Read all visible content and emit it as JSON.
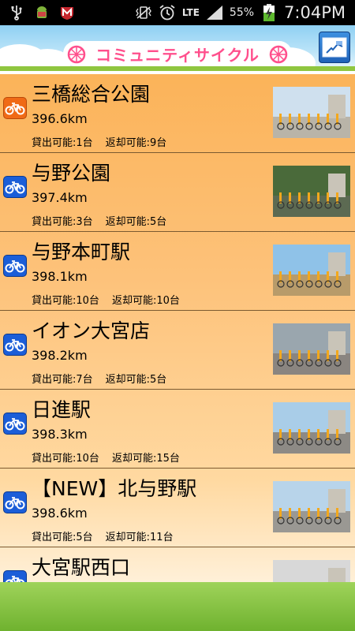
{
  "status_bar": {
    "icons": [
      "usb-icon",
      "android-debug-icon",
      "mcafee-icon",
      "vibrate-icon",
      "alarm-icon",
      "signal-icon",
      "battery-charging-icon"
    ],
    "network": "LTE",
    "battery": "55%",
    "time": "7:04PM"
  },
  "header": {
    "title": "コミュニティサイクル",
    "map_button_icon": "map-icon",
    "colors": {
      "title": "#ff4f8c",
      "sky": "#8fd0f3",
      "bar": "#8fc63f"
    }
  },
  "stations": [
    {
      "name": "三橋総合公園",
      "distance": "396.6km",
      "rent": "貸出可能:1台",
      "return": "返却可能:9台",
      "icon": "bicycle-icon",
      "icon_color": "orange"
    },
    {
      "name": "与野公園",
      "distance": "397.4km",
      "rent": "貸出可能:3台",
      "return": "返却可能:5台",
      "icon": "bicycle-icon",
      "icon_color": "blue"
    },
    {
      "name": "与野本町駅",
      "distance": "398.1km",
      "rent": "貸出可能:10台",
      "return": "返却可能:10台",
      "icon": "bicycle-icon",
      "icon_color": "blue"
    },
    {
      "name": "イオン大宮店",
      "distance": "398.2km",
      "rent": "貸出可能:7台",
      "return": "返却可能:5台",
      "icon": "bicycle-icon",
      "icon_color": "blue"
    },
    {
      "name": "日進駅",
      "distance": "398.3km",
      "rent": "貸出可能:10台",
      "return": "返却可能:15台",
      "icon": "bicycle-icon",
      "icon_color": "blue"
    },
    {
      "name": "【NEW】北与野駅",
      "distance": "398.6km",
      "rent": "貸出可能:5台",
      "return": "返却可能:11台",
      "icon": "bicycle-icon",
      "icon_color": "blue"
    },
    {
      "name": "大宮駅西口",
      "distance": "",
      "rent": "",
      "return": "",
      "icon": "bicycle-icon",
      "icon_color": "blue"
    }
  ]
}
